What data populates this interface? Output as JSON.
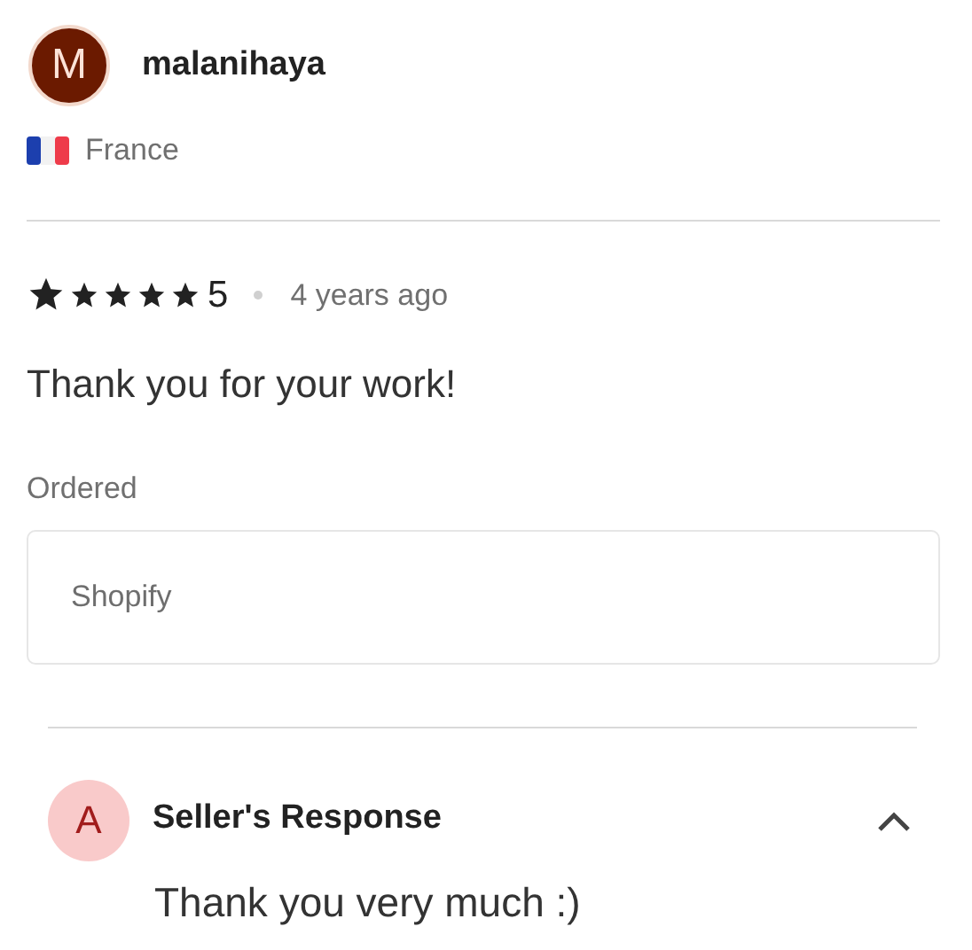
{
  "reviewer": {
    "initial": "M",
    "name": "malanihaya",
    "country": "France"
  },
  "review": {
    "stars": 5,
    "rating": "5",
    "time": "4 years ago",
    "text": "Thank you for your work!"
  },
  "ordered": {
    "label": "Ordered",
    "item": "Shopify"
  },
  "response": {
    "initial": "A",
    "title": "Seller's Response",
    "expanded": true,
    "text": "Thank you very much :)"
  }
}
